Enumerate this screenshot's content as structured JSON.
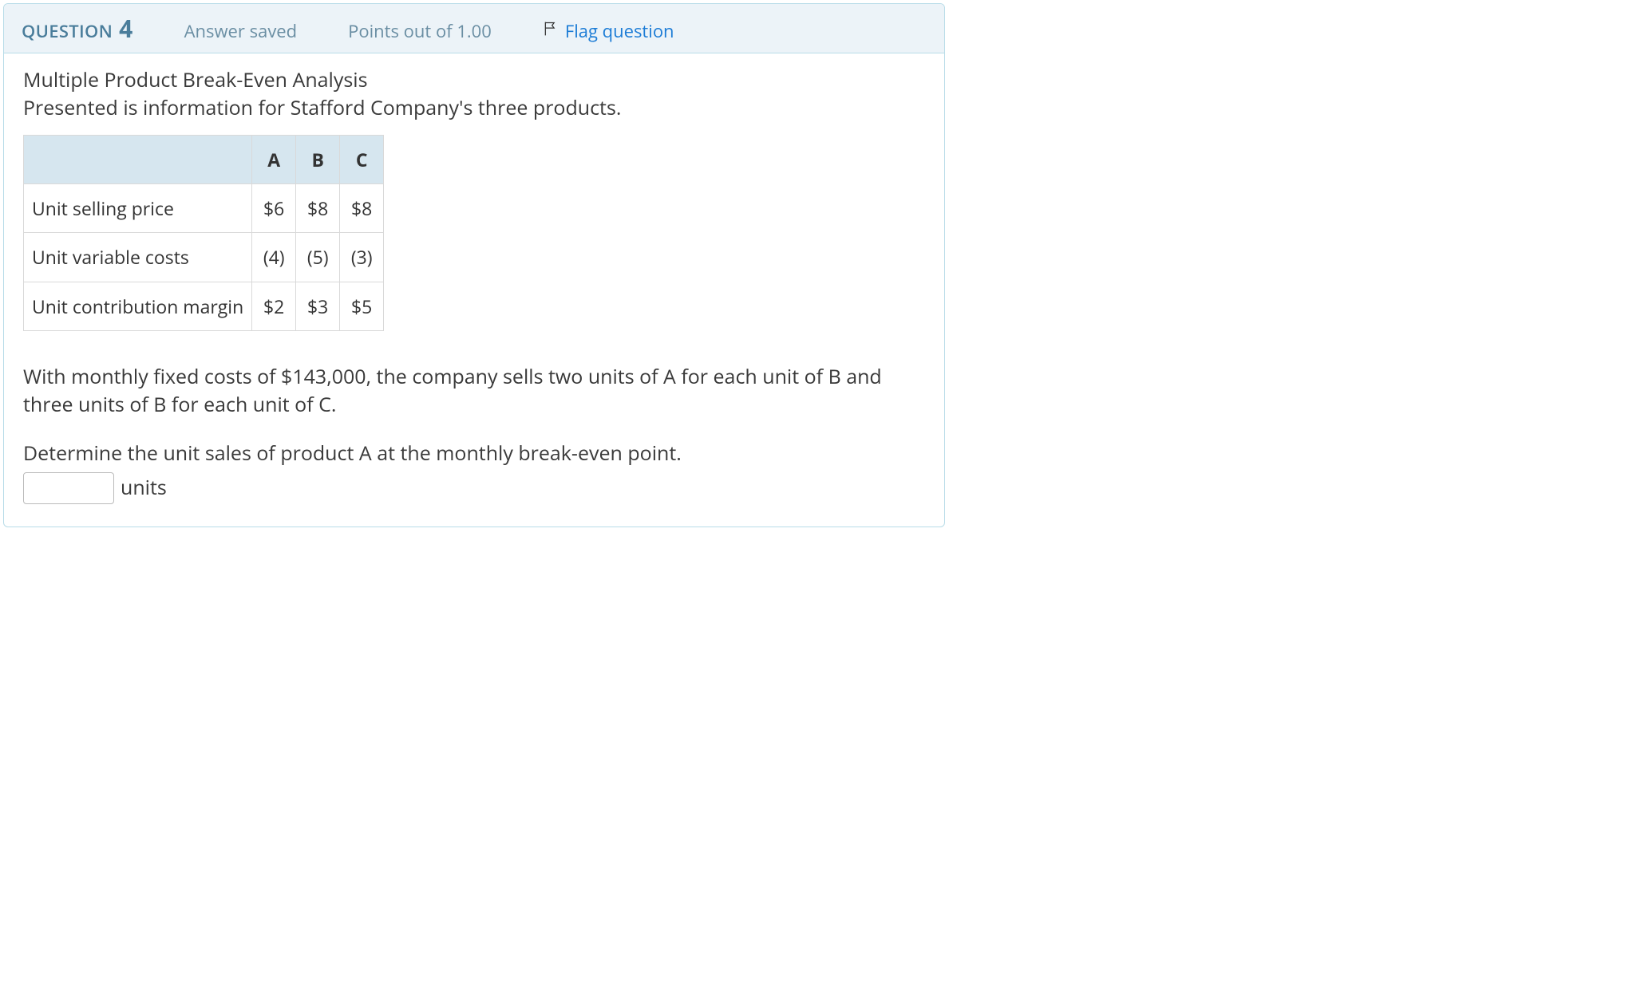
{
  "header": {
    "question_label": "QUESTION",
    "question_number": "4",
    "status": "Answer saved",
    "points": "Points out of 1.00",
    "flag": "Flag question"
  },
  "body": {
    "title": "Multiple Product Break-Even Analysis",
    "subtitle": "Presented is information for Stafford Company's three products.",
    "table": {
      "col_headers": [
        "A",
        "B",
        "C"
      ],
      "rows": [
        {
          "label": "Unit selling price",
          "vals": [
            "$6",
            "$8",
            "$8"
          ]
        },
        {
          "label": "Unit variable costs",
          "vals": [
            "(4)",
            "(5)",
            "(3)"
          ]
        },
        {
          "label": "Unit contribution margin",
          "vals": [
            "$2",
            "$3",
            "$5"
          ]
        }
      ]
    },
    "paragraph1": "With monthly fixed costs of $143,000, the company sells two units of A for each unit of B and three units of B for each unit of C.",
    "paragraph2": "Determine the unit sales of product A at the monthly break-even point.",
    "answer_value": "",
    "units_label": "units"
  }
}
